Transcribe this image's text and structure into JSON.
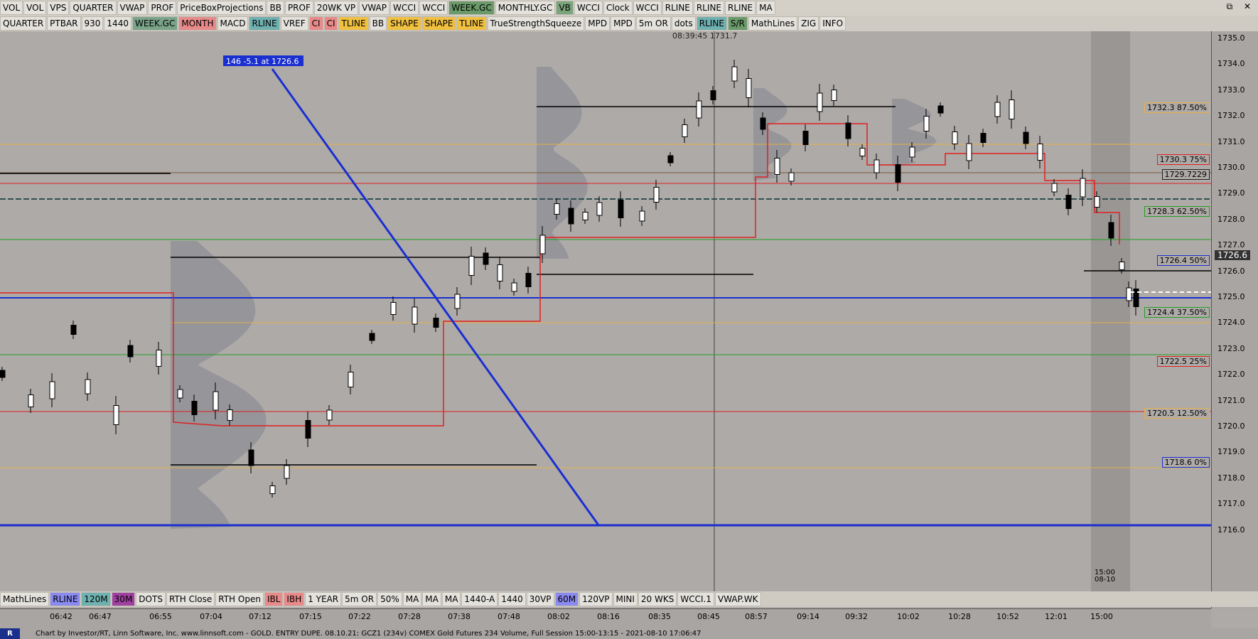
{
  "toolbar_top": [
    "VOL",
    "VOL",
    "VPS",
    "QUARTER",
    "VWAP",
    "PROF",
    "PriceBoxProjections",
    "BB",
    "PROF",
    "20WK VP",
    "VWAP",
    "WCCI",
    "WCCI",
    "WEEK.GC",
    "MONTHLY.GC",
    "VB",
    "WCCI",
    "Clock",
    "WCCI",
    "RLINE",
    "RLINE",
    "RLINE",
    "MA"
  ],
  "toolbar_mid": [
    "QUARTER",
    "PTBAR",
    "930",
    "1440",
    "WEEK.GC",
    "MONTH",
    "MACD",
    "RLINE",
    "VREF",
    "CI",
    "CI",
    "TLINE",
    "BB",
    "SHAPE",
    "SHAPE",
    "TLINE",
    "TrueStrengthSqueeze",
    "MPD",
    "MPD",
    "5m OR",
    "dots",
    "RLINE",
    "S/R",
    "MathLines",
    "ZIG",
    "INFO"
  ],
  "toolbar_bottom": [
    "MathLines",
    "RLINE",
    "120M",
    "30M",
    "DOTS",
    "RTH Close",
    "RTH Open",
    "IBL",
    "IBH",
    "1 YEAR",
    "5m OR",
    "50%",
    "MA",
    "MA",
    "MA",
    "1440-A",
    "1440",
    "30VP",
    "60M",
    "120VP",
    "MINI",
    "20 WKS",
    "WCCI.1",
    "VWAP.WK"
  ],
  "crosshair_readout": "08:39:45  1731.7",
  "trend_label": "146  -5.1 at 1726.6",
  "current_price": "1726.6",
  "y_ticks": [
    "1735.0",
    "1734.0",
    "1733.0",
    "1732.0",
    "1731.0",
    "1730.0",
    "1729.0",
    "1728.0",
    "1727.0",
    "1726.0",
    "1725.0",
    "1724.0",
    "1723.0",
    "1722.0",
    "1721.0",
    "1720.0",
    "1719.0",
    "1718.0",
    "1717.0",
    "1716.0"
  ],
  "x_ticks": [
    "06:42",
    "06:47",
    "06:55",
    "07:04",
    "07:12",
    "07:15",
    "07:22",
    "07:28",
    "07:38",
    "07:48",
    "08:02",
    "08:16",
    "08:35",
    "08:45",
    "08:57",
    "09:14",
    "09:32",
    "10:02",
    "10:28",
    "10:52",
    "12:01",
    "15:00"
  ],
  "session_label": [
    "15:00",
    "08-10"
  ],
  "levels": [
    {
      "text": "1732.3 87.50%",
      "price": 1732.3,
      "color": "#e8b048"
    },
    {
      "text": "1730.3 75%",
      "price": 1730.3,
      "color": "#e02020"
    },
    {
      "text": "1729.7229",
      "price": 1729.72,
      "color": "#202020"
    },
    {
      "text": "1728.3 62.50%",
      "price": 1728.3,
      "color": "#20a020"
    },
    {
      "text": "1726.4 50%",
      "price": 1726.4,
      "color": "#1a2fd0"
    },
    {
      "text": "1724.4 37.50%",
      "price": 1724.4,
      "color": "#20a020"
    },
    {
      "text": "1722.5 25%",
      "price": 1722.5,
      "color": "#e02020"
    },
    {
      "text": "1720.5 12.50%",
      "price": 1720.5,
      "color": "#e8b048"
    },
    {
      "text": "1718.6 0%",
      "price": 1718.6,
      "color": "#1a2fd0"
    }
  ],
  "footer": "Chart by Investor/RT, Linn Software, Inc. www.linnsoft.com - GOLD. ENTRY DUPE. 08.10.21: GCZ1 (234v) COMEX Gold Futures 234 Volume, Full Session 15:00-13:15 - 2021-08-10 17:06:47",
  "colors": {
    "background": "#aeaaa8",
    "blue": "#1a2fd0",
    "red": "#e02020",
    "green": "#20a020",
    "orange": "#e8b048"
  }
}
